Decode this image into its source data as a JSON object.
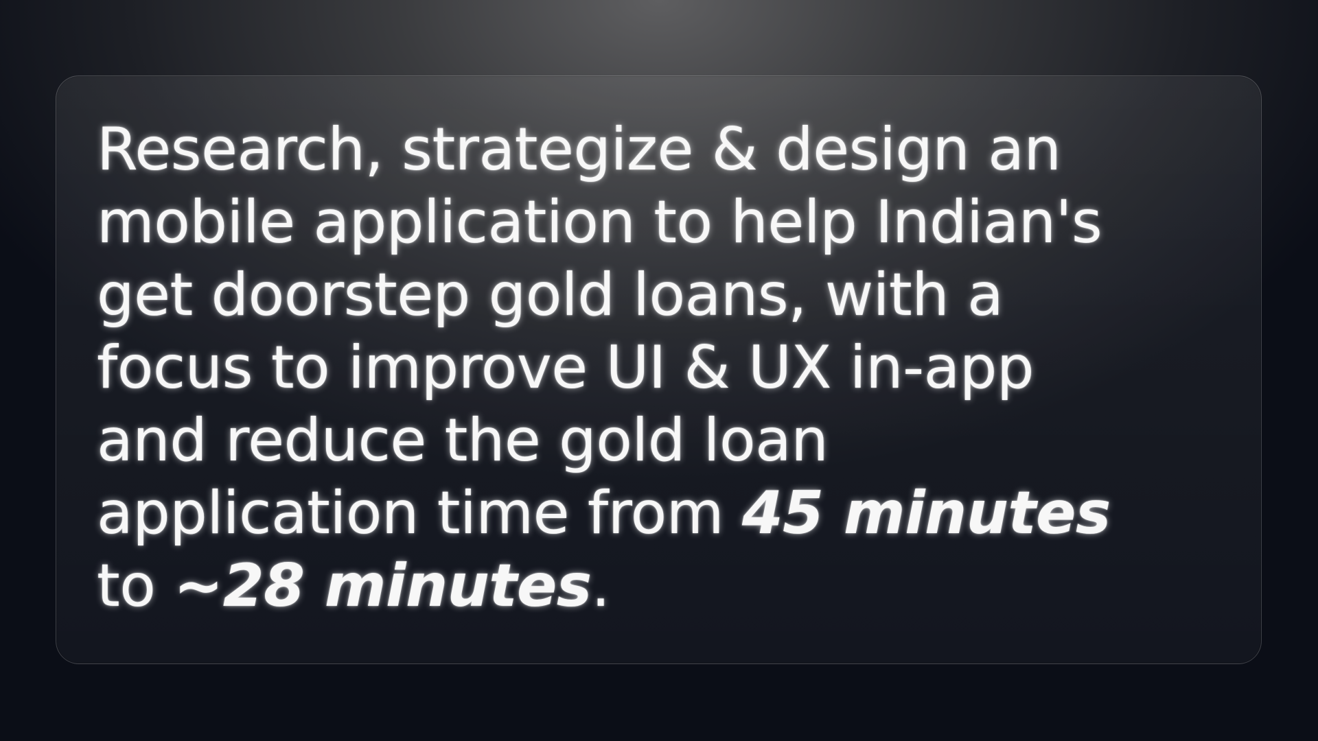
{
  "mission": {
    "lines": [
      "Research, strategize & design an",
      "mobile application to help Indian's",
      "get doorstep gold loans, with a",
      "focus to improve UI & UX in-app",
      "and reduce the gold loan"
    ],
    "line6_prefix": "application time from ",
    "before_time": "45 minutes",
    "line7_prefix": "to ",
    "after_time": "~28 minutes",
    "terminator": "."
  }
}
